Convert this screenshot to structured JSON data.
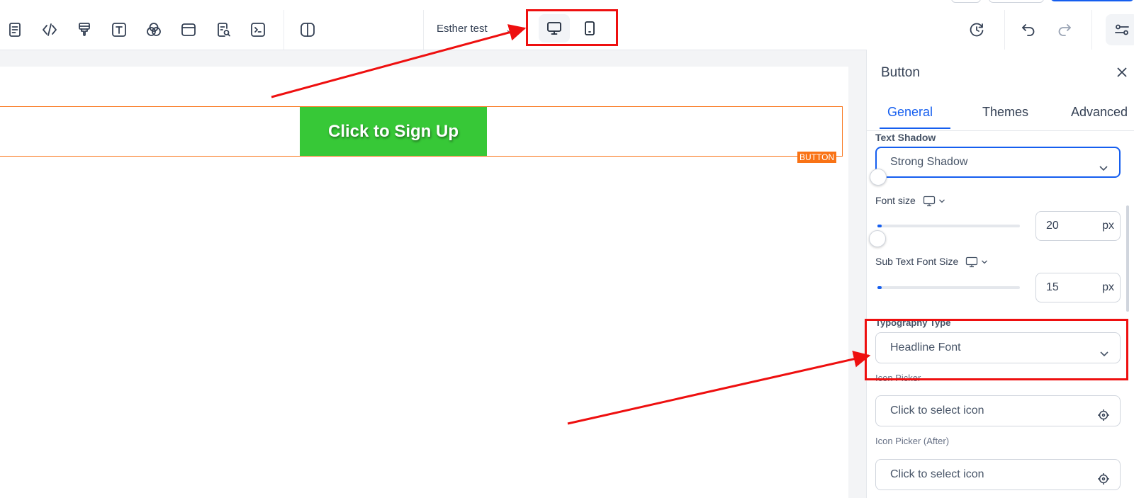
{
  "toolbar": {
    "page_selector": "Esther test",
    "icons": [
      "page-icon",
      "code-icon",
      "paint-brush-icon",
      "text-icon",
      "color-blend-icon",
      "section-icon",
      "form-search-icon",
      "terminal-icon",
      "split-view-icon",
      "history-icon",
      "undo-icon",
      "redo-icon",
      "settings-sliders-icon"
    ],
    "device_modes": [
      "desktop",
      "mobile"
    ],
    "active_device": "desktop"
  },
  "canvas": {
    "button_text": "Click to Sign Up",
    "button_color": "#37c837",
    "selection_tag": "BUTTON"
  },
  "panel": {
    "title": "Button",
    "tabs": [
      "General",
      "Themes",
      "Advanced"
    ],
    "active_tab": "General",
    "text_shadow": {
      "label": "Text Shadow",
      "value": "Strong Shadow"
    },
    "font_size": {
      "label": "Font size",
      "value": "20",
      "unit": "px"
    },
    "sub_font_size": {
      "label": "Sub Text Font Size",
      "value": "15",
      "unit": "px"
    },
    "typography": {
      "label": "Typography Type",
      "value": "Headline Font"
    },
    "icon_picker": {
      "label": "Icon Picker",
      "placeholder": "Click to select icon"
    },
    "icon_picker_after": {
      "label": "Icon Picker (After)",
      "placeholder": "Click to select icon"
    }
  },
  "colors": {
    "accent": "#155eef",
    "annotation": "#ee0f0f",
    "selection": "#f97316"
  }
}
